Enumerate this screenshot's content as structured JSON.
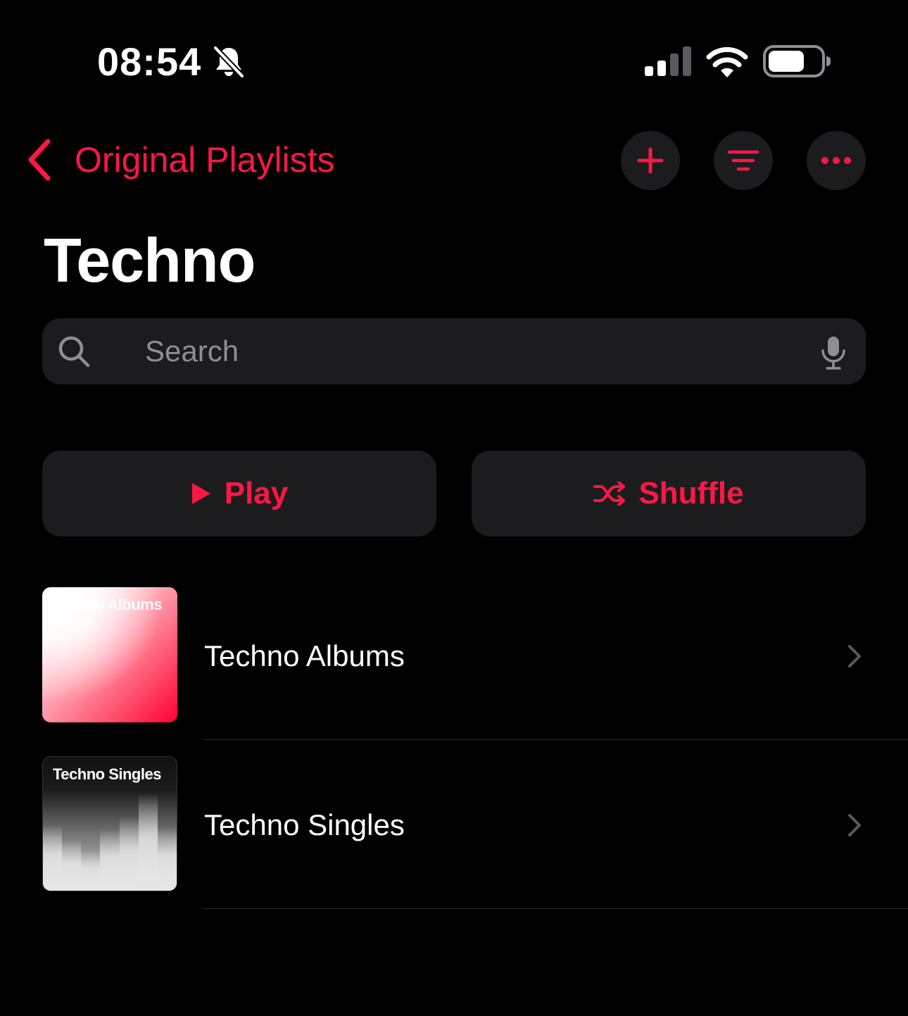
{
  "status_bar": {
    "time": "08:54",
    "silent_icon": "bell-slash-icon",
    "signal_icon": "cellular-signal-icon",
    "wifi_icon": "wifi-icon",
    "battery_icon": "battery-icon"
  },
  "nav": {
    "back_label": "Original Playlists",
    "back_icon": "chevron-left-icon",
    "actions": [
      "plus-icon",
      "filter-icon",
      "ellipsis-icon"
    ]
  },
  "page": {
    "title": "Techno"
  },
  "search": {
    "placeholder": "Search",
    "value": "",
    "mic_icon": "microphone-icon"
  },
  "buttons": {
    "play_label": "Play",
    "shuffle_label": "Shuffle"
  },
  "playlists": [
    {
      "artwork_text": "Techno Albums",
      "title": "Techno Albums"
    },
    {
      "artwork_text": "Techno Singles",
      "title": "Techno Singles"
    }
  ],
  "colors": {
    "accent": "#ff1744",
    "background": "#000000",
    "control_bg": "#1c1c1e",
    "secondary_text": "#8e8e93"
  }
}
